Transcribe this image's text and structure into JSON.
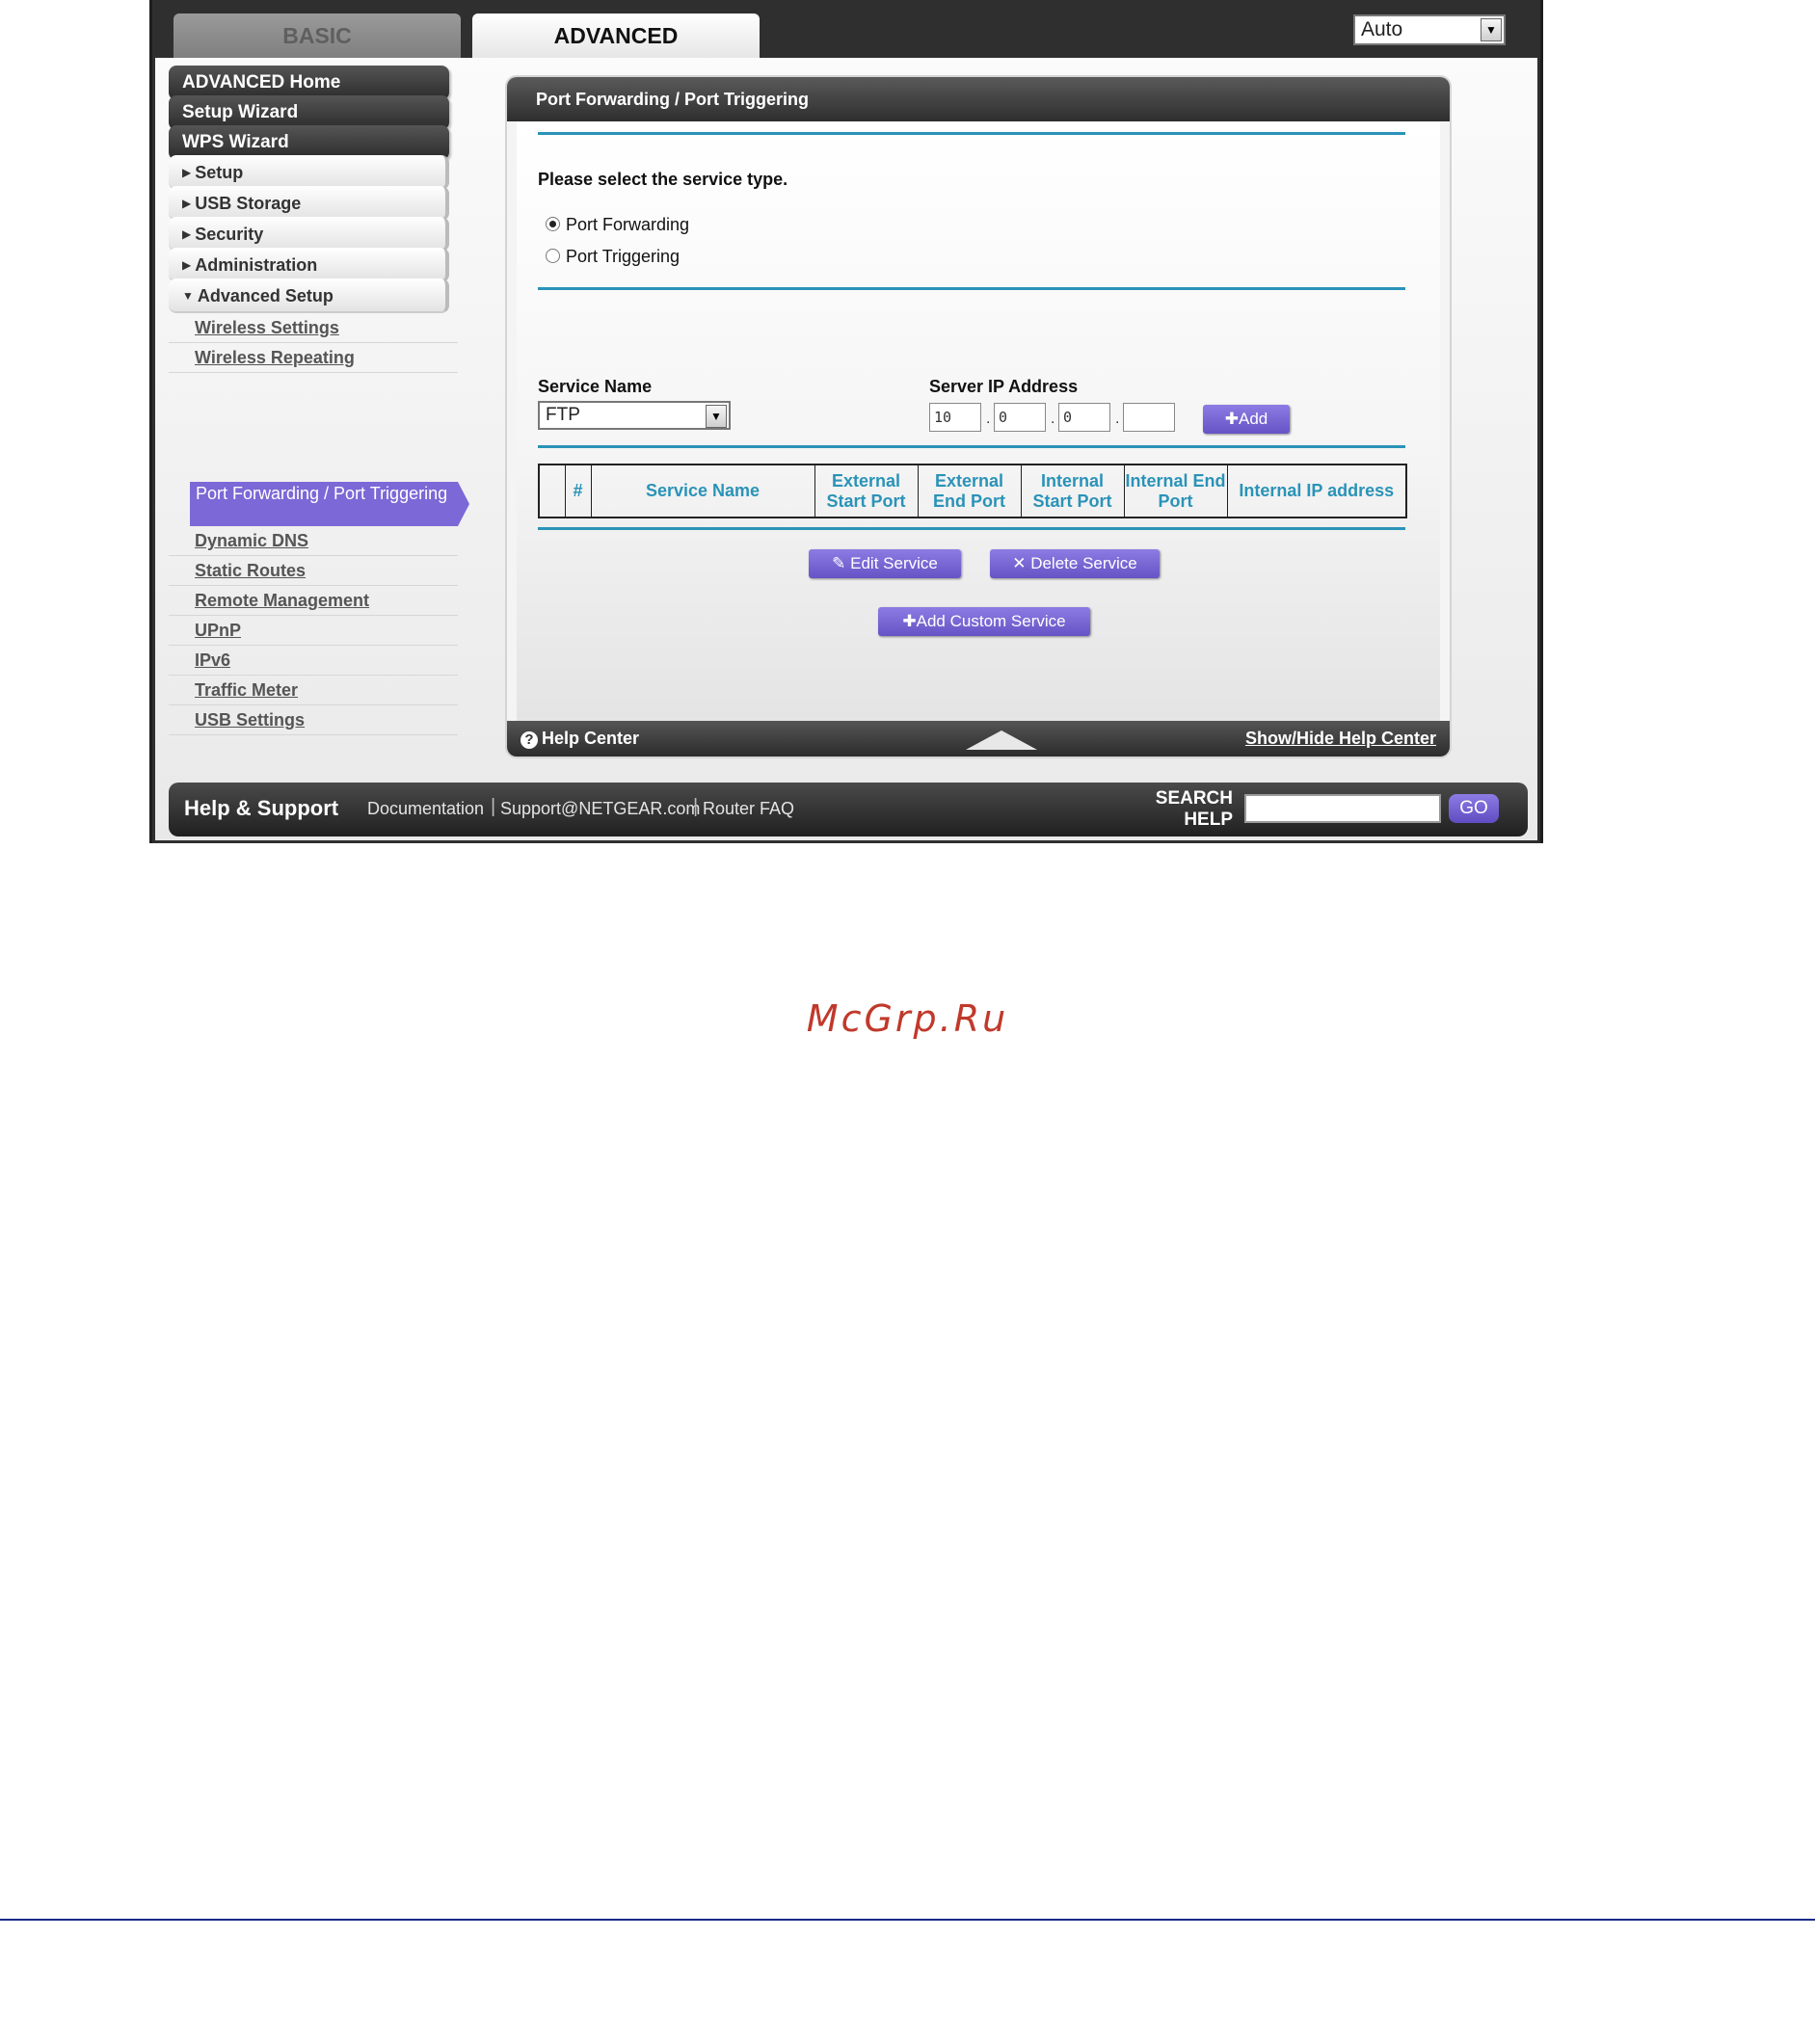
{
  "tabs": {
    "basic": "BASIC",
    "advanced": "ADVANCED"
  },
  "language_select": {
    "value": "Auto"
  },
  "sidebar": {
    "primary": [
      "ADVANCED Home",
      "Setup Wizard",
      "WPS Wizard"
    ],
    "sections": [
      "Setup",
      "USB Storage",
      "Security",
      "Administration",
      "Advanced Setup"
    ],
    "advanced_setup_items": [
      "Wireless Settings",
      "Wireless Repeating",
      "Port Forwarding / Port Triggering",
      "Dynamic DNS",
      "Static Routes",
      "Remote Management",
      "UPnP",
      "IPv6",
      "Traffic Meter",
      "USB Settings"
    ],
    "active_item": "Port Forwarding / Port Triggering"
  },
  "panel": {
    "title": "Port Forwarding / Port Triggering",
    "service_type_prompt": "Please select the service type.",
    "radio_port_forwarding": "Port Forwarding",
    "radio_port_triggering": "Port Triggering",
    "selected_service_type": "Port Forwarding",
    "service_name_label": "Service Name",
    "service_name_value": "FTP",
    "server_ip_label": "Server IP Address",
    "server_ip_octets": [
      "10",
      "0",
      "0",
      ""
    ],
    "add_button": "Add",
    "table_headers": [
      "",
      "#",
      "Service Name",
      "External Start Port",
      "External End Port",
      "Internal Start Port",
      "Internal End Port",
      "Internal IP address"
    ],
    "edit_button": "Edit Service",
    "delete_button": "Delete Service",
    "add_custom_button": "Add Custom Service"
  },
  "help_bar": {
    "label": "Help Center",
    "toggle": "Show/Hide Help Center"
  },
  "footer": {
    "title": "Help & Support",
    "links": [
      "Documentation",
      "Support@NETGEAR.com",
      "Router FAQ"
    ],
    "search_label_1": "SEARCH",
    "search_label_2": "HELP",
    "go_button": "GO"
  },
  "watermark": "McGrp.Ru",
  "colors": {
    "accent_purple": "#7c68d6",
    "rule_teal": "#2a93b8",
    "chrome_dark": "#2f2f2f"
  }
}
